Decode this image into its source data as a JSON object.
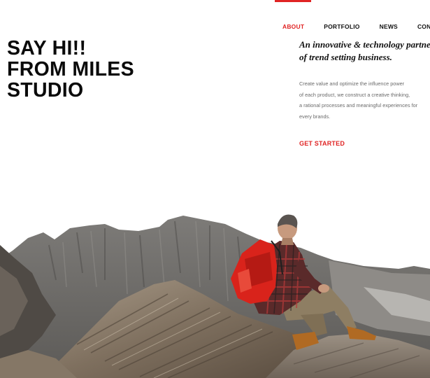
{
  "nav": {
    "items": [
      {
        "label": "ABOUT",
        "active": true
      },
      {
        "label": "PORTFOLIO",
        "active": false
      },
      {
        "label": "NEWS",
        "active": false
      },
      {
        "label": "CONTA",
        "active": false
      }
    ]
  },
  "hero": {
    "title_lines": [
      "SAY HI!!",
      "FROM MILES",
      "STUDIO"
    ],
    "tagline_lines": [
      "An innovative & technology partner",
      "of trend setting business."
    ],
    "description_lines": [
      "Create value and optimize the influence power",
      "of each product, we construct a creative thinking,",
      "a rational processes and meaningful experiences for",
      "every brands."
    ],
    "cta_label": "GET STARTED"
  },
  "image": {
    "subject": "hiker with red backpack sitting on rocky mountain summit"
  },
  "colors": {
    "accent": "#e02424",
    "text_dark": "#0a0a0a",
    "text_muted": "#6a6a6a",
    "background": "#ffffff"
  }
}
